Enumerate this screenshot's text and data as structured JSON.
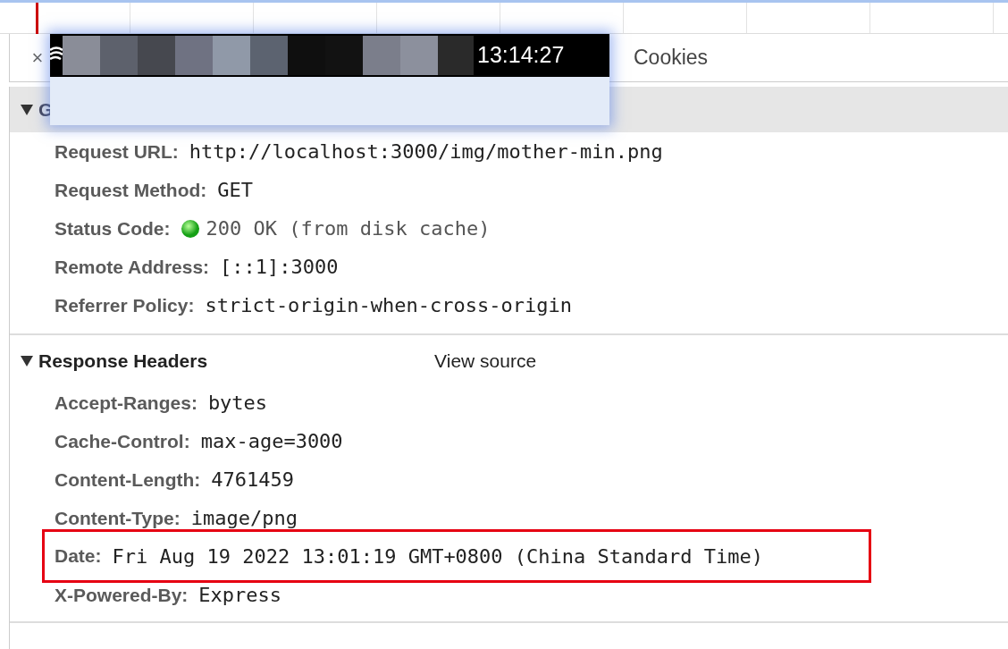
{
  "tab_bar": {
    "close": "×",
    "tabs": [
      {
        "label": "Cookies"
      }
    ]
  },
  "popup": {
    "time": "13:14:27"
  },
  "general": {
    "title": "G",
    "expanded": true,
    "rows": [
      {
        "label": "Request URL:",
        "value": "http://localhost:3000/img/mother-min.png",
        "kind": "plain",
        "highlighted": false
      },
      {
        "label": "Request Method:",
        "value": "GET",
        "kind": "plain",
        "highlighted": false
      },
      {
        "label": "Status Code:",
        "value": "200 OK (from disk cache)",
        "kind": "status",
        "highlighted": false
      },
      {
        "label": "Remote Address:",
        "value": "[::1]:3000",
        "kind": "plain",
        "highlighted": false
      },
      {
        "label": "Referrer Policy:",
        "value": "strict-origin-when-cross-origin",
        "kind": "plain",
        "highlighted": false
      }
    ]
  },
  "response_headers": {
    "title": "Response Headers",
    "expanded": true,
    "view_source": "View source",
    "rows": [
      {
        "label": "Accept-Ranges:",
        "value": "bytes",
        "kind": "plain",
        "highlighted": false
      },
      {
        "label": "Cache-Control:",
        "value": "max-age=3000",
        "kind": "plain",
        "highlighted": false
      },
      {
        "label": "Content-Length:",
        "value": "4761459",
        "kind": "plain",
        "highlighted": false
      },
      {
        "label": "Content-Type:",
        "value": "image/png",
        "kind": "plain",
        "highlighted": false
      },
      {
        "label": "Date:",
        "value": "Fri Aug 19 2022 13:01:19 GMT+0800 (China Standard Time)",
        "kind": "plain",
        "highlighted": true
      },
      {
        "label": "X-Powered-By:",
        "value": "Express",
        "kind": "plain",
        "highlighted": false
      }
    ]
  }
}
